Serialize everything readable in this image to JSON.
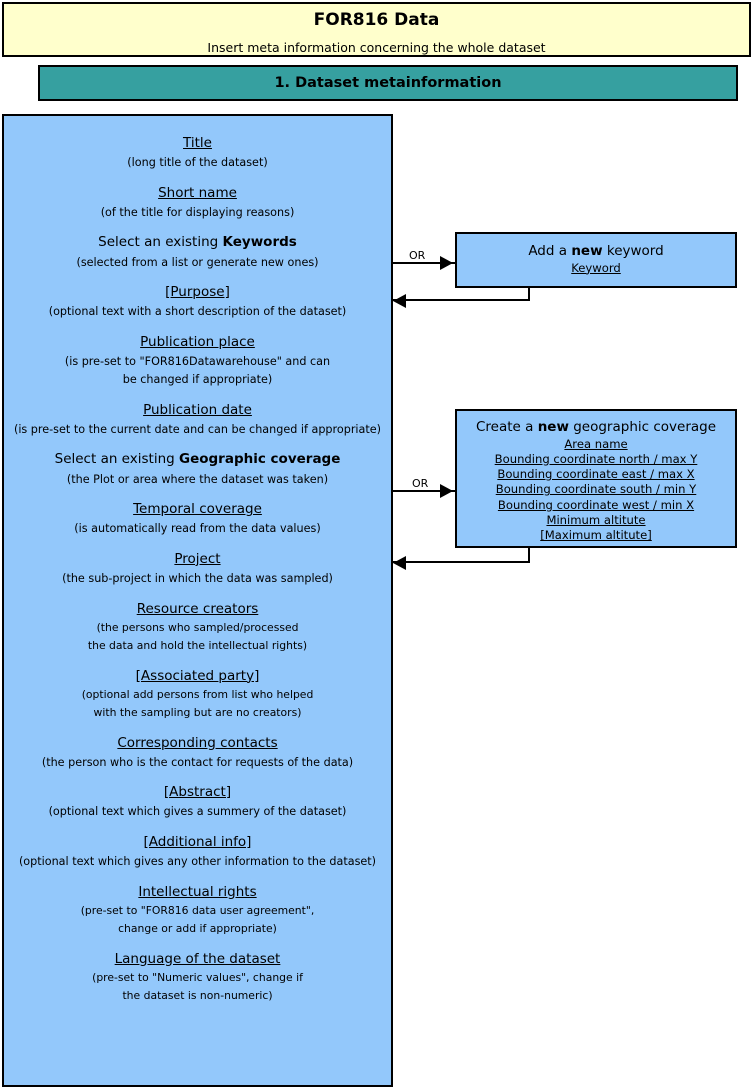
{
  "header": {
    "title": "FOR816 Data",
    "subtitle": "Insert meta information concerning the whole dataset"
  },
  "section_bar": {
    "label": "1. Dataset metainformation"
  },
  "colors": {
    "header_background": "#ffffcc",
    "section_bar_background": "#36a0a0",
    "panel_background": "#93c8fb",
    "border": "#000000",
    "page_background": "#ffffff"
  },
  "main_panel": {
    "fields": [
      {
        "title": "Title",
        "desc": "(long title of the dataset)"
      },
      {
        "title": "Short name",
        "desc": "(of the title for displaying reasons)"
      },
      {
        "title_plain": "Select  an existing ",
        "title_bold": "Keywords",
        "desc": "(selected from a list or generate new ones)"
      },
      {
        "title": "[Purpose]",
        "desc": "(optional text with a short description of the dataset)"
      },
      {
        "title": "Publication place",
        "desc_line1": "(is pre-set to \"FOR816Datawarehouse\" and can",
        "desc_line2": "be changed if appropriate)"
      },
      {
        "title": "Publication date",
        "desc": "(is pre-set to the current date and can be changed if appropriate)"
      },
      {
        "title_plain": "Select an existing ",
        "title_bold": "Geographic coverage",
        "desc": "(the Plot or area where the dataset was taken)"
      },
      {
        "title": "Temporal coverage",
        "desc": "(is automatically read from the data values)"
      },
      {
        "title": "Project",
        "desc": "(the sub-project in which the data was sampled)"
      },
      {
        "title": "Resource creators",
        "desc_line1": "(the persons who sampled/processed",
        "desc_line2": "the data and hold the intellectual rights)"
      },
      {
        "title": "[Associated party]",
        "desc_line1": "(optional add persons from list who helped",
        "desc_line2": "with the sampling but are no creators)"
      },
      {
        "title": "Corresponding contacts",
        "desc": "(the person who is the contact for requests of the data)"
      },
      {
        "title": "[Abstract]",
        "desc": "(optional text which gives a summery of the dataset)"
      },
      {
        "title": "[Additional info]",
        "desc": "(optional text which gives any other information to the dataset)"
      },
      {
        "title": "Intellectual rights",
        "desc_line1": "(pre-set to \"FOR816 data user agreement\",",
        "desc_line2": "change or add if appropriate)"
      },
      {
        "title": "Language of the dataset",
        "desc_line1": "(pre-set to \"Numeric values\", change if",
        "desc_line2": "the dataset is non-numeric)"
      }
    ]
  },
  "keyword_box": {
    "heading_plain_before": "Add a ",
    "heading_bold": "new",
    "heading_plain_after": " keyword",
    "fields": [
      "Keyword"
    ]
  },
  "geo_box": {
    "heading_plain_before": "Create a ",
    "heading_bold": "new",
    "heading_plain_after": " geographic coverage",
    "fields": [
      "Area name",
      "Bounding coordinate north / max Y",
      "Bounding coordinate east / max X",
      "Bounding coordinate south / min Y",
      "Bounding coordinate west / min X",
      "Minimum altitute",
      "[Maximum altitute]"
    ]
  },
  "connectors": {
    "keyword_or_label": "OR",
    "geo_or_label": "OR"
  }
}
